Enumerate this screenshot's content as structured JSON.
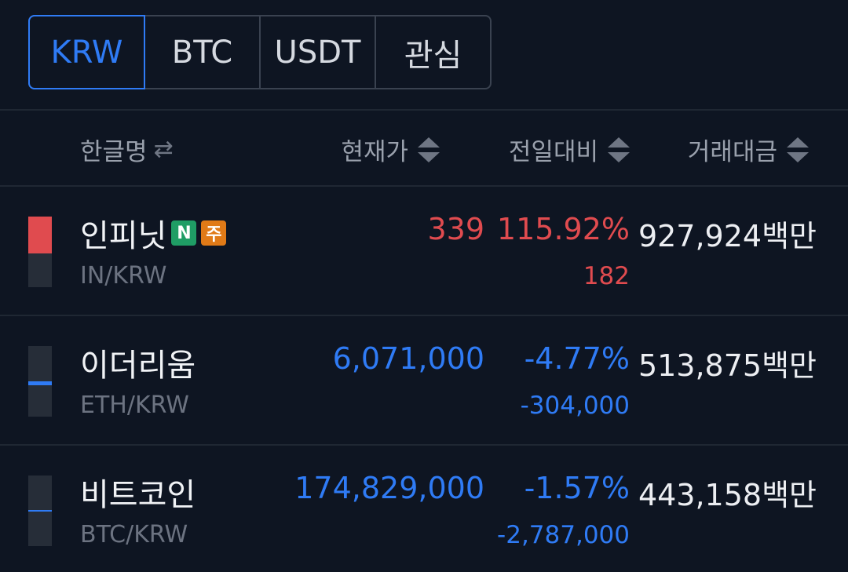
{
  "tabs": [
    {
      "label": "KRW",
      "active": true
    },
    {
      "label": "BTC",
      "active": false
    },
    {
      "label": "USDT",
      "active": false
    },
    {
      "label": "관심",
      "active": false
    }
  ],
  "columns": {
    "name": "한글명",
    "price": "현재가",
    "change": "전일대비",
    "volume": "거래대금"
  },
  "colors": {
    "rise": "#e04b4f",
    "fall": "#2f7bf5",
    "accent": "#2f7bf5"
  },
  "rows": [
    {
      "name": "인피닛",
      "badges": [
        "N",
        "주"
      ],
      "symbol": "IN/KRW",
      "price": "339",
      "rate": "115.92%",
      "change": "182",
      "volume": "927,924백만",
      "direction": "rise"
    },
    {
      "name": "이더리움",
      "symbol": "ETH/KRW",
      "price": "6,071,000",
      "rate": "-4.77%",
      "change": "-304,000",
      "volume": "513,875백만",
      "direction": "fall"
    },
    {
      "name": "비트코인",
      "symbol": "BTC/KRW",
      "price": "174,829,000",
      "rate": "-1.57%",
      "change": "-2,787,000",
      "volume": "443,158백만",
      "direction": "fall"
    }
  ]
}
